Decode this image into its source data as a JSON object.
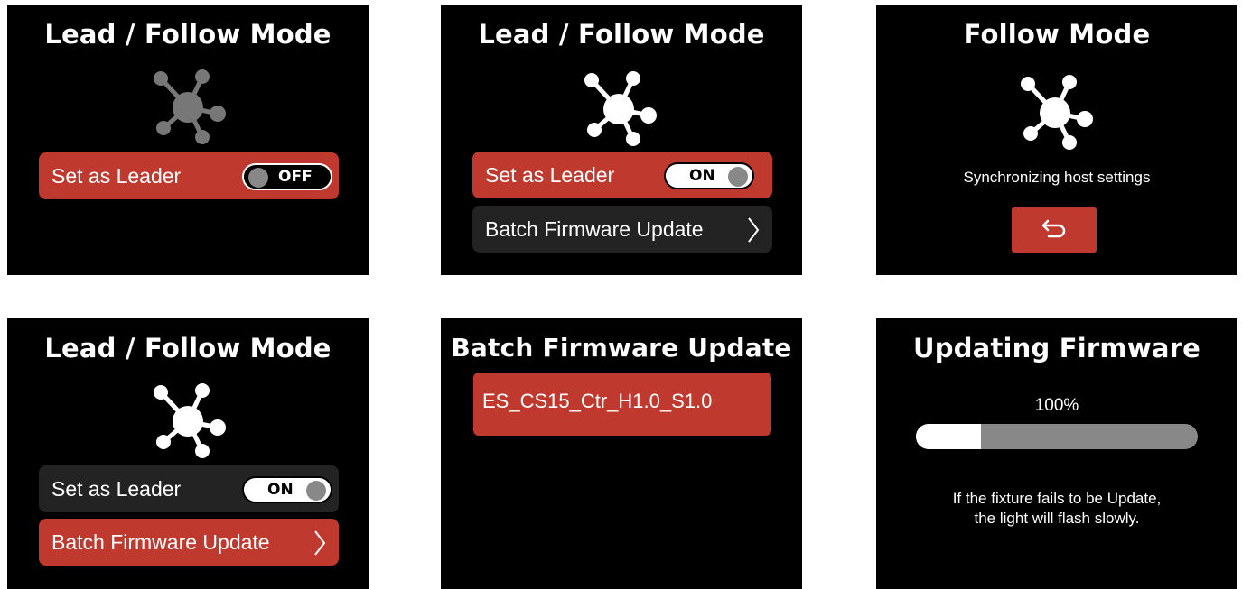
{
  "screens": {
    "s1": {
      "title": "Lead / Follow Mode",
      "leader_row": {
        "label": "Set as Leader",
        "toggle_state": "OFF",
        "selected": true
      },
      "hub_icon": "network-hub-icon",
      "hub_color": "#777777"
    },
    "s2": {
      "title": "Lead / Follow Mode",
      "leader_row": {
        "label": "Set as Leader",
        "toggle_state": "ON",
        "selected": true
      },
      "firmware_row": {
        "label": "Batch Firmware Update",
        "selected": false,
        "chevron": "〉"
      },
      "hub_icon": "network-hub-icon",
      "hub_color": "#ffffff"
    },
    "s3": {
      "title": "Follow Mode",
      "message": "Synchronizing host settings",
      "back_icon": "back-arrow-icon",
      "hub_icon": "network-hub-icon",
      "hub_color": "#ffffff"
    },
    "s4": {
      "title": "Lead / Follow Mode",
      "leader_row": {
        "label": "Set as Leader",
        "toggle_state": "ON",
        "selected": false
      },
      "firmware_row": {
        "label": "Batch Firmware Update",
        "selected": true,
        "chevron": "〉"
      },
      "hub_icon": "network-hub-icon",
      "hub_color": "#ffffff"
    },
    "s5": {
      "title": "Batch Firmware Update",
      "items": [
        "ES_CS15_Ctr_H1.0_S1.0"
      ]
    },
    "s6": {
      "title": "Updating Firmware",
      "progress_text": "100%",
      "progress_fraction": 0.23,
      "note_line1": "If the fixture fails to be Update,",
      "note_line2": "the light will flash slowly."
    }
  },
  "colors": {
    "accent": "#c0392f",
    "row_dark": "#232323",
    "screen_bg": "#000000",
    "knob": "#888888"
  }
}
